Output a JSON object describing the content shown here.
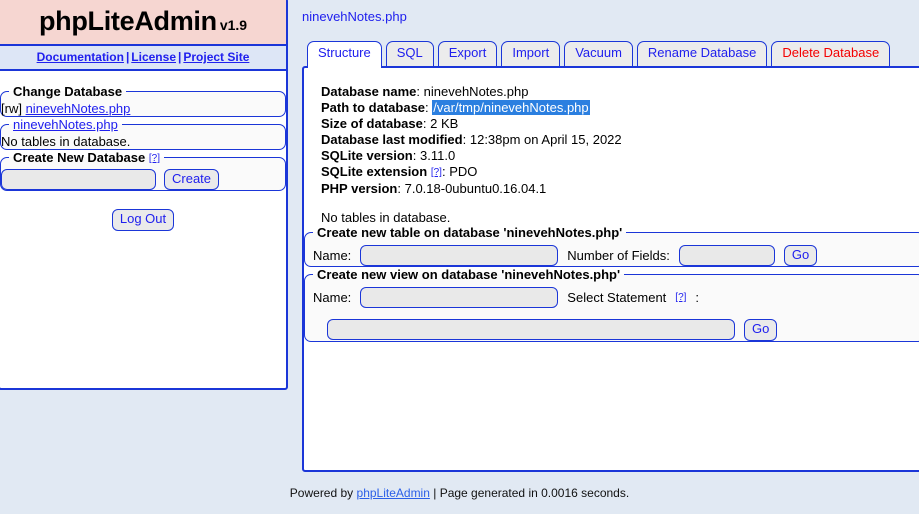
{
  "brand": {
    "title": "phpLiteAdmin",
    "version": "v1.9",
    "nav": [
      {
        "label": "Documentation"
      },
      {
        "label": "License"
      },
      {
        "label": "Project Site"
      }
    ],
    "nav_separator": "|"
  },
  "sidebar": {
    "change_database": {
      "legend": "Change Database",
      "permission": "[rw]",
      "db_link": "ninevehNotes.php"
    },
    "current_database": {
      "legend": "ninevehNotes.php",
      "body": "No tables in database."
    },
    "create_database": {
      "legend": "Create New Database",
      "help": "[?]",
      "input_value": "",
      "input_placeholder": "",
      "create_label": "Create"
    },
    "logout_label": "Log Out"
  },
  "main": {
    "breadcrumb": "ninevehNotes.php",
    "tabs": [
      {
        "label": "Structure",
        "active": true,
        "danger": false
      },
      {
        "label": "SQL",
        "active": false,
        "danger": false
      },
      {
        "label": "Export",
        "active": false,
        "danger": false
      },
      {
        "label": "Import",
        "active": false,
        "danger": false
      },
      {
        "label": "Vacuum",
        "active": false,
        "danger": false
      },
      {
        "label": "Rename Database",
        "active": false,
        "danger": false
      },
      {
        "label": "Delete Database",
        "active": false,
        "danger": true
      }
    ],
    "info": {
      "database_name_key": "Database name",
      "database_name_value": "ninevehNotes.php",
      "path_key": "Path to database",
      "path_value": "/var/tmp/ninevehNotes.php",
      "size_key": "Size of database",
      "size_value": "2 KB",
      "modified_key": "Database last modified",
      "modified_value": "12:38pm on April 15, 2022",
      "sqlite_version_key": "SQLite version",
      "sqlite_version_value": "3.11.0",
      "sqlite_ext_key": "SQLite extension",
      "sqlite_ext_help": "[?]",
      "sqlite_ext_value": "PDO",
      "php_version_key": "PHP version",
      "php_version_value": "7.0.18-0ubuntu0.16.04.1",
      "colon": ":"
    },
    "no_tables": "No tables in database.",
    "create_table": {
      "legend": "Create new table on database 'ninevehNotes.php'",
      "name_label": "Name:",
      "name_value": "",
      "fields_label": "Number of Fields:",
      "fields_value": "",
      "go_label": "Go"
    },
    "create_view": {
      "legend": "Create new view on database 'ninevehNotes.php'",
      "name_label": "Name:",
      "name_value": "",
      "select_label": "Select Statement",
      "select_help": "[?]",
      "select_colon": ":",
      "statement_value": "",
      "go_label": "Go"
    }
  },
  "footer": {
    "powered_by": "Powered by",
    "link": "phpLiteAdmin",
    "rest": "| Page generated in 0.0016 seconds."
  }
}
